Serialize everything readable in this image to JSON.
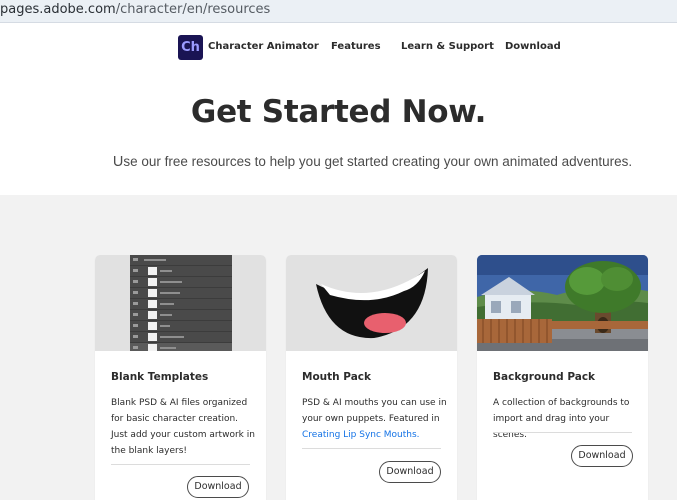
{
  "browser": {
    "url_host": "pages.adobe.com",
    "url_path": "/character/en/resources"
  },
  "nav": {
    "logo_text": "Ch",
    "brand": "Character Animator",
    "links": [
      "Features",
      "Learn & Support",
      "Download"
    ]
  },
  "hero": {
    "title": "Get Started Now.",
    "subtitle_lead": "U",
    "subtitle": "se our free resources to help you get started creating your own animated adventures."
  },
  "cards": [
    {
      "title": "Blank Templates",
      "description": "Blank PSD & AI files organized for basic character creation. Just add your custom artwork in the blank layers!",
      "button": "Download"
    },
    {
      "title": "Mouth Pack",
      "description": "PSD & AI mouths you can use in your own puppets. Featured in",
      "link": "Creating Lip Sync Mouths.",
      "button": "Download"
    },
    {
      "title": "Background Pack",
      "description": "A collection of backgrounds to import and drag into your scenes.",
      "button": "Download"
    }
  ],
  "colors": {
    "brand_badge": "#1a1454",
    "brand_badge_text": "#9b9bff",
    "link": "#1473e6",
    "page_bg": "#f2f2f2"
  },
  "icons": {
    "logo": "character-animator-logo"
  }
}
